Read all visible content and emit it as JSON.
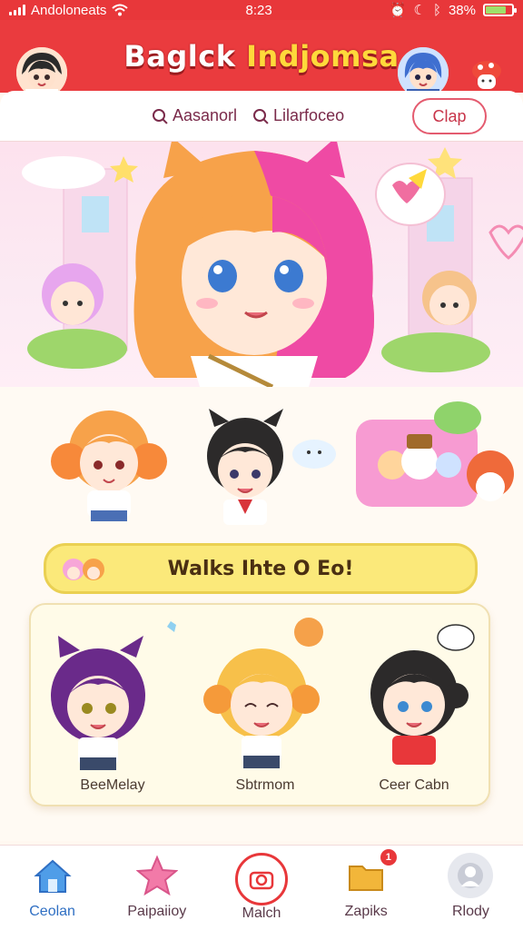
{
  "status": {
    "carrier": "Andoloneats",
    "time": "8:23",
    "battery": "38%"
  },
  "header": {
    "title_left": "Baglck",
    "title_right": "Indjomsa"
  },
  "search": {
    "chip1": "Aasanorl",
    "chip2": "Lilarfoceo",
    "button": "Clap"
  },
  "featured": {
    "banner": "Walks Ihte O Eo!",
    "characters": [
      {
        "name": "BeeMelay"
      },
      {
        "name": "Sbtrmom"
      },
      {
        "name": "Ceer Cabn"
      }
    ]
  },
  "tabs": [
    {
      "label": "Ceolan",
      "icon": "home-icon",
      "color": "#4f9de8"
    },
    {
      "label": "Paipaiioy",
      "icon": "star-icon",
      "color": "#f27aa8"
    },
    {
      "label": "Malch",
      "icon": "camera-icon",
      "color": "#e8373a"
    },
    {
      "label": "Zapiks",
      "icon": "folder-icon",
      "color": "#f2b63a",
      "badge": "1"
    },
    {
      "label": "Rlody",
      "icon": "globe-icon",
      "color": "#b8bcc6"
    }
  ],
  "colors": {
    "accent": "#ea3b3e",
    "banner": "#fbe97a"
  }
}
